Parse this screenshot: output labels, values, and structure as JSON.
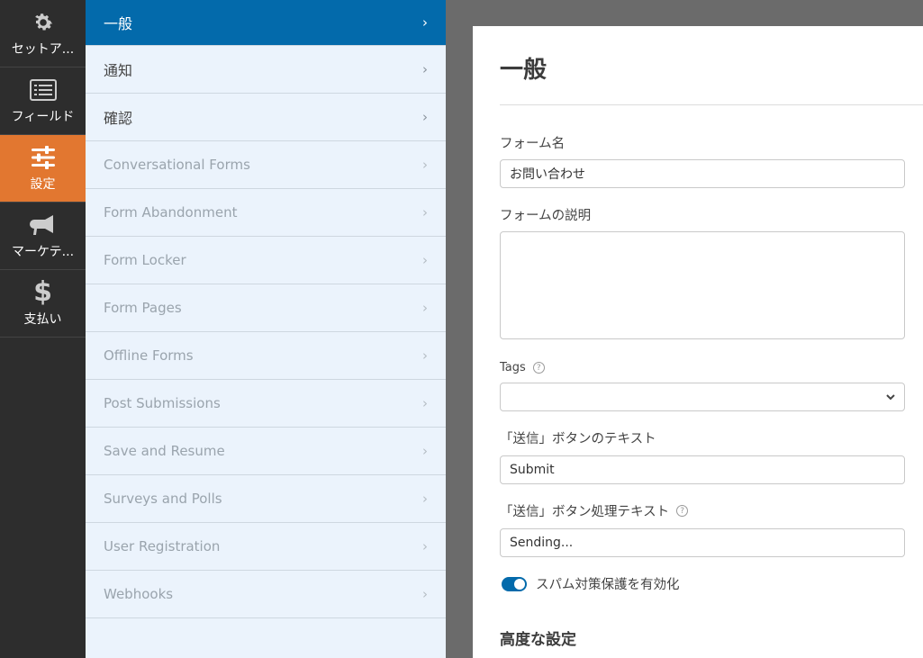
{
  "rail": {
    "items": [
      {
        "label": "セットア...",
        "icon": "gear-icon"
      },
      {
        "label": "フィールド",
        "icon": "list-icon"
      },
      {
        "label": "設定",
        "icon": "sliders-icon",
        "active": true
      },
      {
        "label": "マーケテ...",
        "icon": "megaphone-icon"
      },
      {
        "label": "支払い",
        "icon": "dollar-icon"
      }
    ]
  },
  "sections": {
    "items": [
      {
        "label": "一般",
        "state": "active"
      },
      {
        "label": "通知",
        "state": "normal"
      },
      {
        "label": "確認",
        "state": "normal"
      },
      {
        "label": "Conversational Forms",
        "state": "disabled"
      },
      {
        "label": "Form Abandonment",
        "state": "disabled"
      },
      {
        "label": "Form Locker",
        "state": "disabled"
      },
      {
        "label": "Form Pages",
        "state": "disabled"
      },
      {
        "label": "Offline Forms",
        "state": "disabled"
      },
      {
        "label": "Post Submissions",
        "state": "disabled"
      },
      {
        "label": "Save and Resume",
        "state": "disabled"
      },
      {
        "label": "Surveys and Polls",
        "state": "disabled"
      },
      {
        "label": "User Registration",
        "state": "disabled"
      },
      {
        "label": "Webhooks",
        "state": "disabled"
      }
    ],
    "chevron": "›"
  },
  "panel": {
    "title": "一般",
    "form_name_label": "フォーム名",
    "form_name_value": "お問い合わせ",
    "form_desc_label": "フォームの説明",
    "form_desc_value": "",
    "tags_label": "Tags",
    "tags_help": "?",
    "submit_text_label": "「送信」ボタンのテキスト",
    "submit_text_value": "Submit",
    "submit_processing_label": "「送信」ボタン処理テキスト",
    "submit_processing_help": "?",
    "submit_processing_value": "Sending...",
    "spam_toggle_label": "スパム対策保護を有効化",
    "spam_toggle_on": true,
    "advanced_title": "高度な設定"
  },
  "colors": {
    "rail_bg": "#2d2d2d",
    "rail_active": "#e27730",
    "section_bg": "#ebf3fc",
    "section_active": "#036aab",
    "toggle_on": "#036aab"
  }
}
